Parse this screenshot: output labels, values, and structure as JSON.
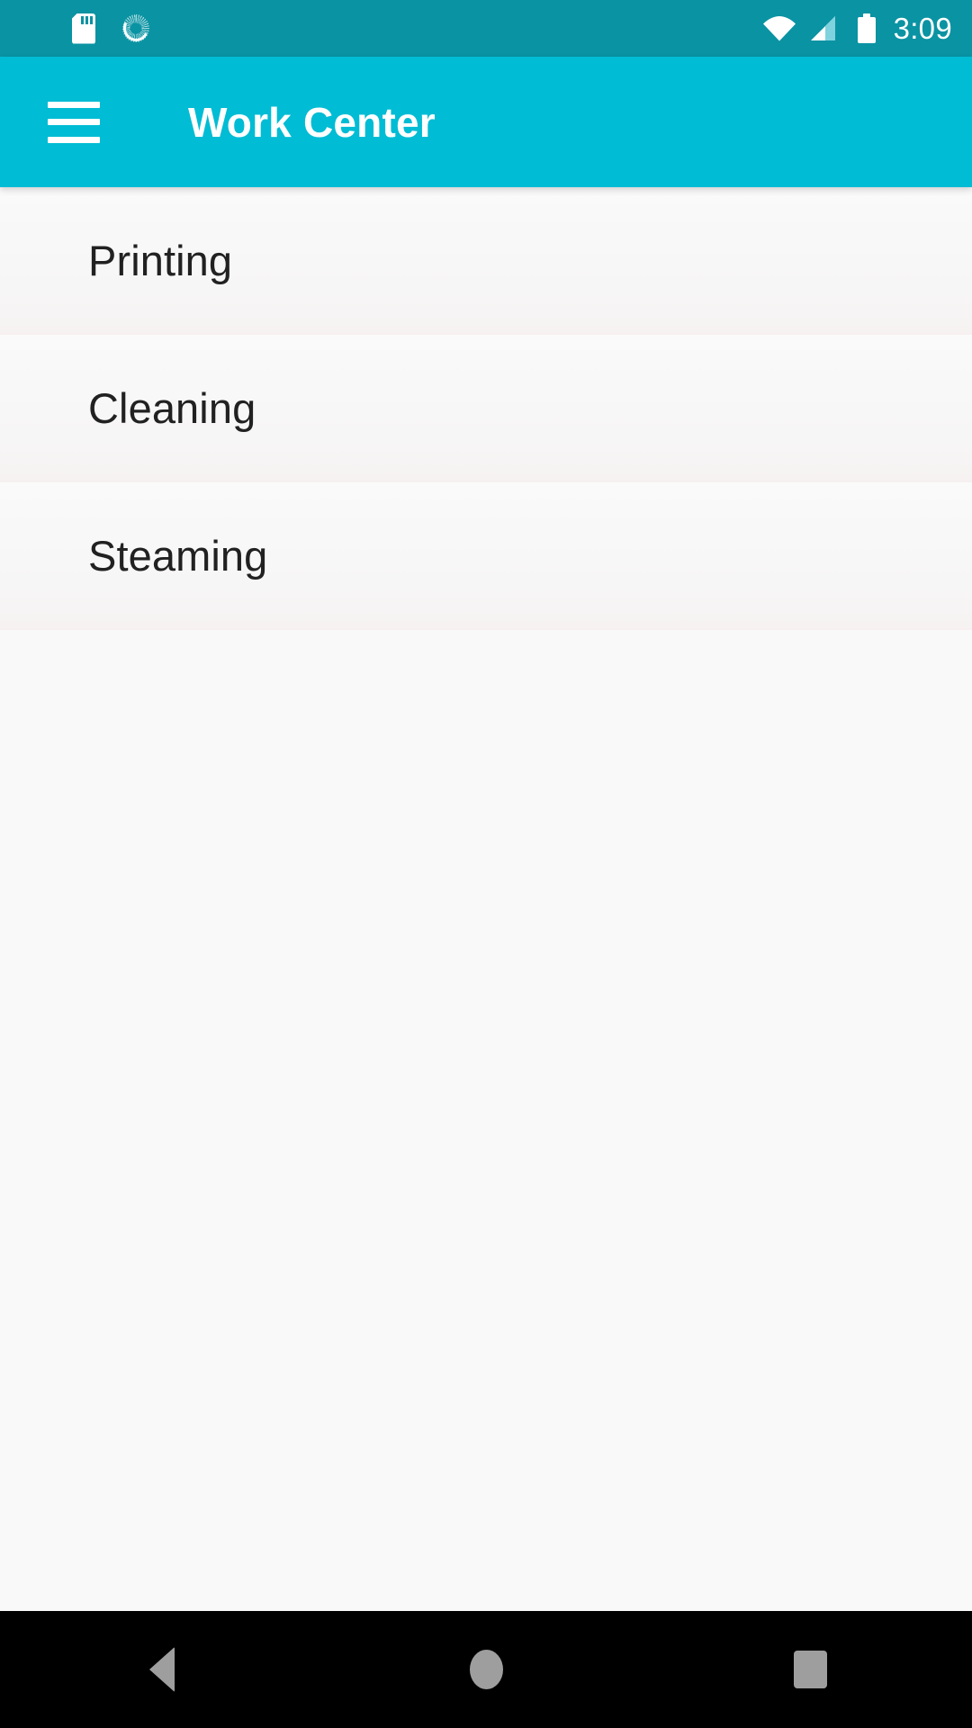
{
  "status_bar": {
    "background_color": "#0a93a3",
    "time": "3:09",
    "left_icons": [
      {
        "name": "sd-card-icon",
        "label": "SD card"
      },
      {
        "name": "sync-icon",
        "label": "Sync"
      }
    ],
    "right_icons": [
      {
        "name": "wifi-icon",
        "label": "Wi-Fi"
      },
      {
        "name": "cellular-signal-icon",
        "label": "Cellular signal"
      },
      {
        "name": "battery-icon",
        "label": "Battery full"
      }
    ]
  },
  "app_bar": {
    "background_color": "#00bcd4",
    "title": "Work Center",
    "menu_icon": "hamburger-menu-icon"
  },
  "list": {
    "items": [
      {
        "label": "Printing"
      },
      {
        "label": "Cleaning"
      },
      {
        "label": "Steaming"
      }
    ]
  },
  "nav_bar": {
    "background_color": "#000000",
    "buttons": [
      {
        "name": "back-button",
        "icon": "triangle-left-icon",
        "label": "Back"
      },
      {
        "name": "home-button",
        "icon": "circle-icon",
        "label": "Home"
      },
      {
        "name": "recents-button",
        "icon": "square-icon",
        "label": "Recent apps"
      }
    ]
  }
}
